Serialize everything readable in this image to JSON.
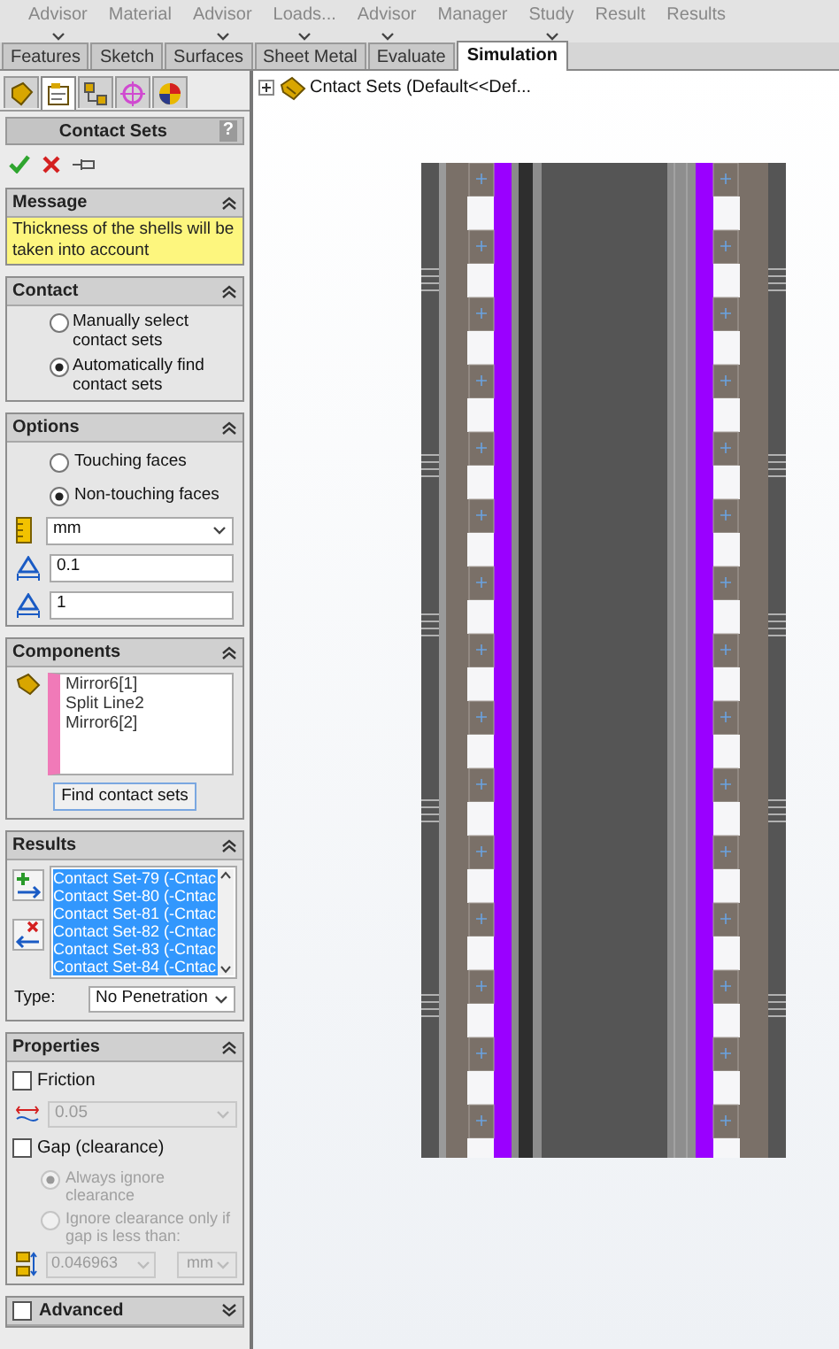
{
  "ribbon": {
    "items": [
      {
        "label": "Advisor",
        "caret": true
      },
      {
        "label": "Material",
        "caret": false
      },
      {
        "label": "Advisor",
        "caret": true
      },
      {
        "label": "Loads...",
        "caret": true
      },
      {
        "label": "Advisor",
        "caret": true
      },
      {
        "label": "Manager",
        "caret": false
      },
      {
        "label": "Study",
        "caret": true
      },
      {
        "label": "Result",
        "caret": false
      },
      {
        "label": "Results",
        "caret": false
      }
    ]
  },
  "tabs": [
    {
      "label": "Features",
      "selected": false
    },
    {
      "label": "Sketch",
      "selected": false
    },
    {
      "label": "Surfaces",
      "selected": false
    },
    {
      "label": "Sheet Metal",
      "selected": false
    },
    {
      "label": "Evaluate",
      "selected": false
    },
    {
      "label": "Simulation",
      "selected": true
    }
  ],
  "property_manager": {
    "icon_tabs": [
      {
        "kind": "feature",
        "selected": false
      },
      {
        "kind": "property",
        "selected": true
      },
      {
        "kind": "configuration",
        "selected": false
      },
      {
        "kind": "target",
        "selected": false
      },
      {
        "kind": "display",
        "selected": false
      }
    ],
    "title": "Contact Sets",
    "help": "?",
    "message": {
      "title": "Message",
      "expanded": true,
      "text": "Thickness of the shells will be taken into account"
    },
    "contact": {
      "title": "Contact",
      "expanded": true,
      "options": [
        {
          "label": "Manually select contact sets",
          "selected": false
        },
        {
          "label": "Automatically find contact sets",
          "selected": true
        }
      ]
    },
    "options": {
      "title": "Options",
      "expanded": true,
      "choices": [
        {
          "label": "Touching faces",
          "selected": false
        },
        {
          "label": "Non-touching faces",
          "selected": true
        }
      ],
      "unit": "mm",
      "min_value": "0.1",
      "max_value": "1"
    },
    "components": {
      "title": "Components",
      "expanded": true,
      "items": [
        "Mirror6[1]",
        "Split Line2",
        "Mirror6[2]"
      ],
      "button": "Find contact sets"
    },
    "results": {
      "title": "Results",
      "expanded": true,
      "items": [
        {
          "label": "Contact Set-79 (-Cntac",
          "selected": true
        },
        {
          "label": "Contact Set-80 (-Cntac",
          "selected": true
        },
        {
          "label": "Contact Set-81 (-Cntac",
          "selected": true
        },
        {
          "label": "Contact Set-82 (-Cntac",
          "selected": true
        },
        {
          "label": "Contact Set-83 (-Cntac",
          "selected": true
        },
        {
          "label": "Contact Set-84 (-Cntac",
          "selected": true
        }
      ],
      "type_label": "Type:",
      "type_value": "No Penetration"
    },
    "properties": {
      "title": "Properties",
      "expanded": true,
      "friction": {
        "label": "Friction",
        "checked": false,
        "value": "0.05",
        "disabled": true
      },
      "gap": {
        "label": "Gap (clearance)",
        "checked": false,
        "disabled": true,
        "options": [
          {
            "label": "Always ignore clearance",
            "selected": true
          },
          {
            "label": "Ignore clearance only if gap is less than:",
            "selected": false
          }
        ],
        "value": "0.046963",
        "unit": "mm"
      }
    },
    "advanced": {
      "title": "Advanced",
      "checked": false,
      "expanded": false
    }
  },
  "tree": {
    "label": "Cntact Sets (Default<<Def...",
    "expanded": false
  }
}
